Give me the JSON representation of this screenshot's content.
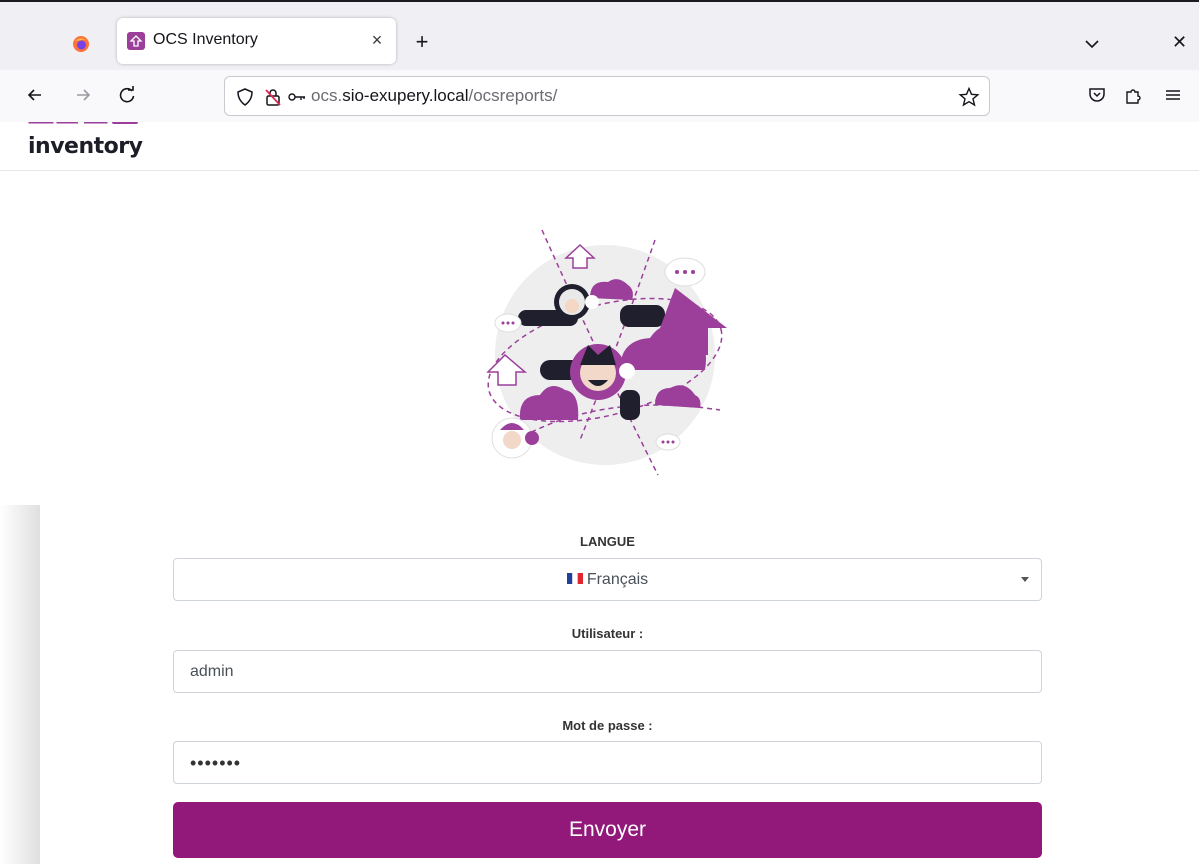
{
  "browser": {
    "tab_title": "OCS Inventory",
    "url_scheme_host_prefix": "ocs.",
    "url_host": "sio-exupery.local",
    "url_path": "/ocsreports/",
    "icons": {
      "firefox": "firefox-icon",
      "favicon": "ocs-favicon",
      "close_tab": "close-icon",
      "new_tab": "plus-icon",
      "list_tabs": "chevron-down-icon",
      "back": "arrow-left-icon",
      "forward": "arrow-right-icon",
      "reload": "reload-icon",
      "tracking": "shield-icon",
      "insecure": "lock-slash-icon",
      "permissions": "key-icon",
      "bookmark": "star-icon",
      "pocket": "pocket-icon",
      "extensions": "puzzle-icon",
      "menu": "hamburger-icon",
      "window_close": "close-icon"
    },
    "glyphs": {
      "close": "×",
      "plus": "+",
      "window_close": "✕"
    }
  },
  "page": {
    "logo_text": "inventory",
    "form": {
      "language_label": "LANGUE",
      "language_value": "Français",
      "user_label": "Utilisateur :",
      "user_value": "admin",
      "password_label": "Mot de passe :",
      "password_value": "•••••••",
      "submit_label": "Envoyer"
    }
  },
  "colors": {
    "brand_purple": "#92187a",
    "illustration_purple": "#9b3f9b",
    "illustration_dark": "#1f1f2d"
  }
}
